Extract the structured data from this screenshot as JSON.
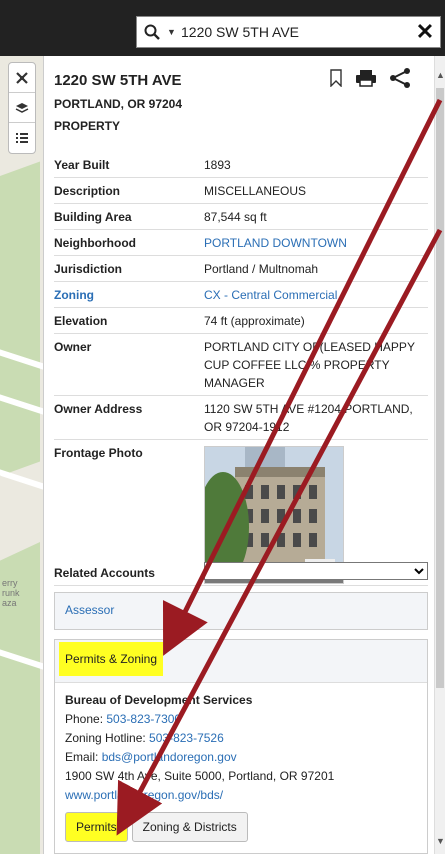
{
  "search": {
    "value": "1220 SW 5TH AVE",
    "search_icon": "search-icon",
    "dropdown_icon": "caret-down-icon",
    "clear_icon": "close-icon"
  },
  "map": {
    "label_lines": [
      "erry",
      "runk",
      "aza"
    ]
  },
  "tools": {
    "icons": [
      "pin-off-icon",
      "layers-icon",
      "list-icon"
    ]
  },
  "property": {
    "address": "1220 SW 5TH AVE",
    "city": "PORTLAND, OR 97204",
    "type": "PROPERTY",
    "icons": [
      "bookmark-icon",
      "print-icon",
      "share-icon"
    ]
  },
  "details": [
    {
      "key": "Year Built",
      "value": "1893",
      "key_link": false,
      "value_link": false
    },
    {
      "key": "Description",
      "value": "MISCELLANEOUS",
      "key_link": false,
      "value_link": false
    },
    {
      "key": "Building Area",
      "value": "87,544 sq ft",
      "key_link": false,
      "value_link": false
    },
    {
      "key": "Neighborhood",
      "value": "PORTLAND DOWNTOWN",
      "key_link": false,
      "value_link": true
    },
    {
      "key": "Jurisdiction",
      "value": "Portland / Multnomah",
      "key_link": false,
      "value_link": false
    },
    {
      "key": "Zoning",
      "value": "CX - Central Commercial",
      "key_link": true,
      "value_link": true
    },
    {
      "key": "Elevation",
      "value": "74 ft (approximate)",
      "key_link": false,
      "value_link": false
    },
    {
      "key": "Owner",
      "value": "PORTLAND CITY OF(LEASED HAPPY CUP COFFEE LLC % PROPERTY MANAGER",
      "key_link": false,
      "value_link": false
    },
    {
      "key": "Owner Address",
      "value": "1120 SW 5TH AVE #1204 PORTLAND, OR 97204-1912",
      "key_link": false,
      "value_link": false
    }
  ],
  "frontage": {
    "key": "Frontage Photo"
  },
  "related": {
    "key": "Related Accounts",
    "selected": ""
  },
  "assessor": {
    "title": "Assessor"
  },
  "permits": {
    "title": "Permits & Zoning",
    "org": "Bureau of Development Services",
    "phone_label": "Phone: ",
    "phone": "503-823-7300",
    "hotline_label": "Zoning Hotline: ",
    "hotline": "503-823-7526",
    "email_label": "Email: ",
    "email": "bds@portlandoregon.gov",
    "address": "1900 SW 4th Ave, Suite 5000, Portland, OR 97201",
    "website": "www.portlandoregon.gov/bds/",
    "buttons": [
      "Permits",
      "Zoning & Districts"
    ]
  },
  "colors": {
    "link": "#2a6eb5",
    "highlight": "#ffff22",
    "arrow": "#9b1b22",
    "topbar": "#222222"
  }
}
